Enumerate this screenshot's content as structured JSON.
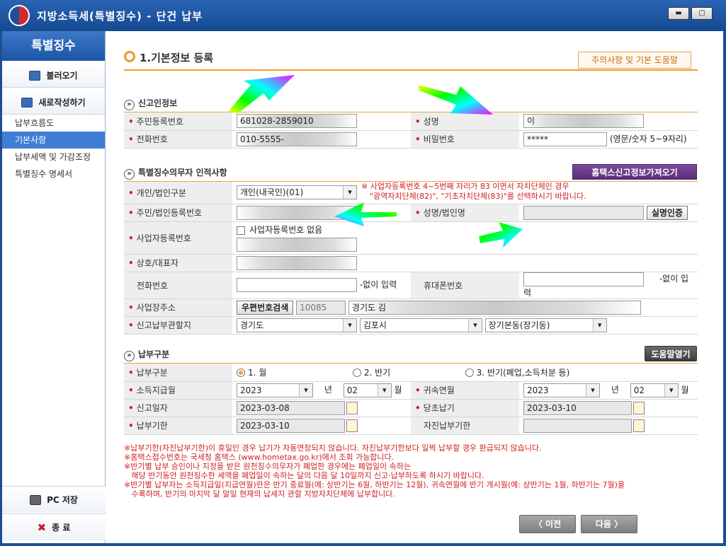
{
  "window": {
    "title": "지방소득세(특별징수) - 단건 납부"
  },
  "sidebar": {
    "header": "특별징수",
    "load_button": "불러오기",
    "new_button": "새로작성하기",
    "items": [
      "납부흐름도",
      "기본사항",
      "납부세액 및 가감조정",
      "특별징수 명세서"
    ],
    "active_index": 1,
    "save_button": "PC 저장",
    "exit_button": "종 료"
  },
  "page": {
    "title": "1.기본정보 등록",
    "help_button": "주의사항 및 기본 도움말"
  },
  "section1": {
    "title": "신고인정보",
    "ssn_label": "주민등록번호",
    "ssn_value": "681028-2859010",
    "name_label": "성명",
    "name_value": "이",
    "phone_label": "전화번호",
    "phone_value": "010-5555-",
    "pw_label": "비밀번호",
    "pw_value": "*****",
    "pw_hint": "(영문/숫자 5~9자리)"
  },
  "section2": {
    "title": "특별징수의무자 인적사항",
    "fetch_button": "홈택스신고정보가져오기",
    "type_label": "개인/법인구분",
    "type_value": "개인(내국인)(01)",
    "note_line1": "※ 사업자등록번호 4~5번째 자리가 83 이면서 자치단체인 경우",
    "note_line2": "\"광역자치단체(82)\", \"기초자치단체(83)\"를 선택하시기 바랍니다.",
    "reg_label": "주민/법인등록번호",
    "corp_name_label": "성명/법인명",
    "verify_button": "실명인증",
    "biz_label": "사업자등록번호",
    "no_biz_label": "사업자등록번호 없음",
    "trade_label": "상호/대표자",
    "tel_label": "전화번호",
    "tel_suffix": "-없이 입력",
    "mobile_label": "휴대폰번호",
    "mobile_suffix": "-없이 입력",
    "addr_label": "사업장주소",
    "zip_button": "우편번호검색",
    "zip_value": "10085",
    "addr_value": "경기도 김",
    "office_label": "신고납부관할지",
    "region1": "경기도",
    "region2": "김포시",
    "region3": "장기본동(장기동)"
  },
  "section3": {
    "title": "납부구분",
    "help_button": "도움말열기",
    "kind_label": "납부구분",
    "opt1": "1. 월",
    "opt2": "2. 반기",
    "opt3": "3. 반기(폐업,소득처분 등)",
    "pay_month_label": "소득지급월",
    "pay_year": "2023",
    "year_unit": "년",
    "pay_month": "02",
    "month_unit": "월",
    "attr_month_label": "귀속연월",
    "attr_year": "2023",
    "attr_month": "02",
    "report_date_label": "신고일자",
    "report_date": "2023-03-08",
    "due_label": "당초납기",
    "due_date": "2023-03-10",
    "deadline_label": "납부기한",
    "deadline_date": "2023-03-10",
    "self_deadline_label": "자진납부기한"
  },
  "notes": [
    "※납부기한(자진납부기한)이 휴일인 경우 납기가 자동연장되지 않습니다. 자진납부기한보다 일찍 납부할 경우 환급되지 않습니다.",
    "※홈택스접수번호는 국세청 홈택스 (www.hometax.go.kr)에서 조회 가능합니다.",
    "※반기별 납부 승인이나 지정을 받은 원천징수의무자가 폐업한 경우에는 폐업일이 속하는",
    "   해당 반기동안 원천징수한 세액을 폐업일이 속하는 달의 다음 달 10일까지 신고·납부하도록 하시기 바랍니다.",
    "※반기별 납부자는 소득지급일(지급연월)란은 반기 종료월(예: 상반기는 6월, 하반기는 12월), 귀속연월에 반기 개시월(예: 상반기는 1월, 하반기는 7월)을",
    "   수록하며, 반기의 마지막 달 말일 현재의 납세지 관할 지방자치단체에 납부합니다."
  ],
  "nav": {
    "prev": "〈 이전",
    "next": "다음 〉"
  }
}
